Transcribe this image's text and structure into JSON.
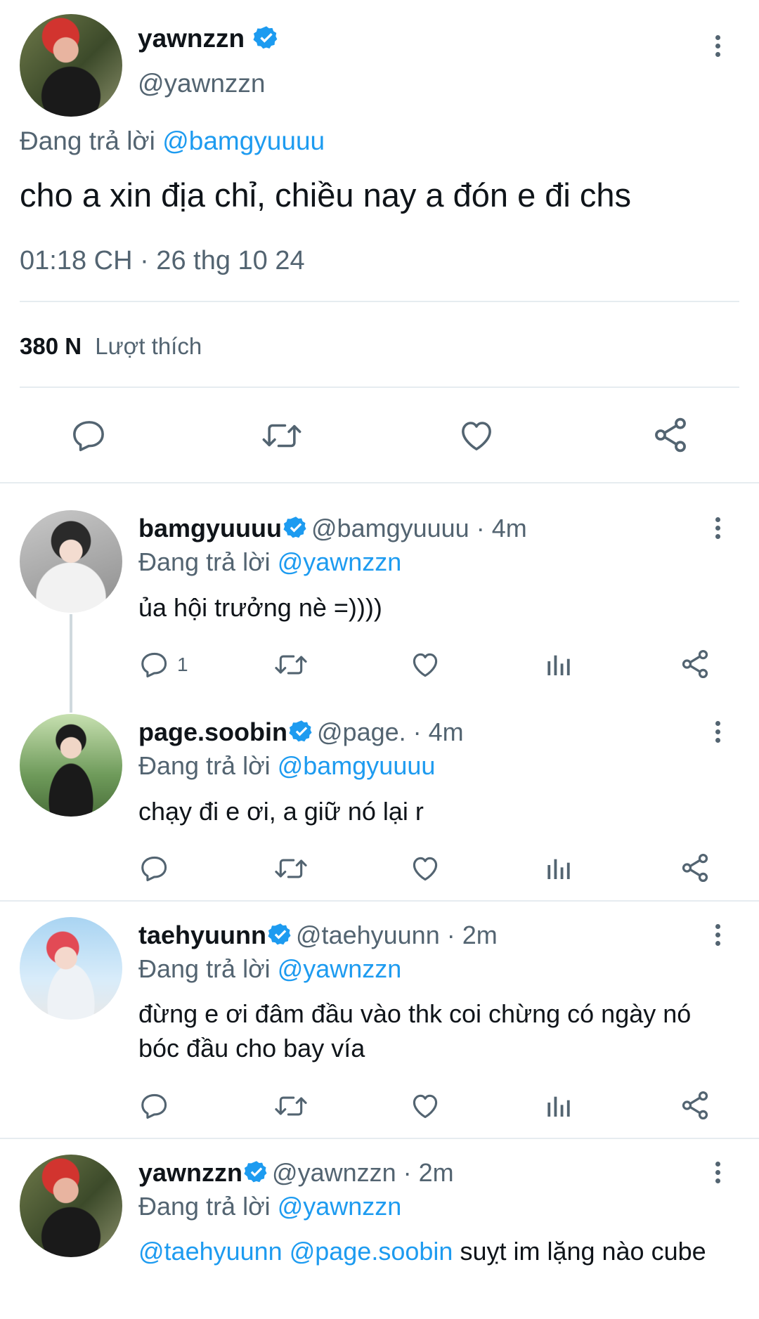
{
  "main_tweet": {
    "display_name": "yawnzzn",
    "handle": "@yawnzzn",
    "replying_label": "Đang trả lời",
    "replying_to": "@bamgyuuuu",
    "text": "cho a xin địa chỉ, chiều nay a đón e đi chs",
    "timestamp": "01:18 CH · 26 thg 10 24",
    "likes_count": "380 N",
    "likes_label": "Lượt thích"
  },
  "replies": [
    {
      "display_name": "bamgyuuuu",
      "handle": "@bamgyuuuu",
      "time": "· 4m",
      "replying_label": "Đang trả lời",
      "replying_to": "@yawnzzn",
      "text": "ủa hội trưởng nè =))))",
      "reply_count": "1"
    },
    {
      "display_name": "page.soobin",
      "handle": "@page.",
      "time": "· 4m",
      "replying_label": "Đang trả lời",
      "replying_to": "@bamgyuuuu",
      "text": "chạy đi e ơi, a giữ nó lại r",
      "reply_count": ""
    },
    {
      "display_name": "taehyuunn",
      "handle": "@taehyuunn",
      "time": "· 2m",
      "replying_label": "Đang trả lời",
      "replying_to": "@yawnzzn",
      "text": "đừng e ơi đâm đầu vào thk coi chừng có ngày nó bóc đầu cho bay vía",
      "reply_count": ""
    },
    {
      "display_name": "yawnzzn",
      "handle": "@yawnzzn",
      "time": "· 2m",
      "replying_label": "Đang trả lời",
      "replying_to": "@yawnzzn",
      "mentions": "@taehyuunn @page.soobin",
      "text": "suỵt im lặng nào cube",
      "reply_count": ""
    }
  ],
  "colors": {
    "accent": "#1d9bf0",
    "muted": "#536471",
    "divider": "#e6ecf0"
  },
  "icons": [
    "verified-badge-icon",
    "more-options-icon",
    "reply-icon",
    "retweet-icon",
    "like-icon",
    "share-icon",
    "analytics-icon"
  ]
}
